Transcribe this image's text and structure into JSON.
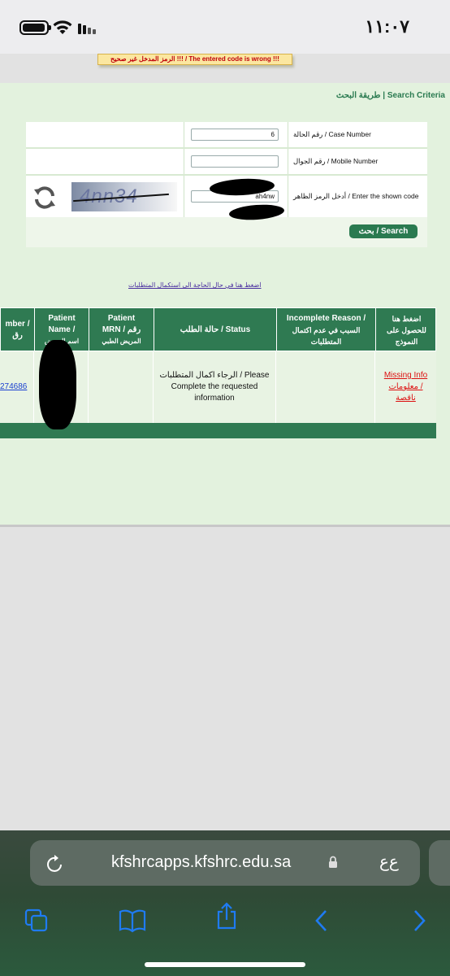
{
  "status": {
    "time": "١١:٠٧"
  },
  "page": {
    "error_message": "الرمز المدخل غير صحيح !!! / The entered code is wrong !!!",
    "criteria_title": "طريقة البحث | Search Criteria",
    "form": {
      "case_label": "رقم الحالة / Case Number",
      "case_value": "6",
      "mobile_label": "رقم الجوال / Mobile Number",
      "mobile_value": "",
      "code_label": "أدخل الرمز الظاهر / Enter the shown code",
      "code_value": "ah4nw",
      "captcha_text": "4nn34",
      "search_label": "بحث / Search"
    },
    "requirements_link": "اضغط هنا في حال الحاجة الى استكمال المتطلبات",
    "table": {
      "headers": {
        "case_number": [
          "mber /",
          "رق"
        ],
        "patient_name": [
          "Patient",
          "Name /",
          "اسم المريض"
        ],
        "patient_mrn": [
          "Patient",
          "MRN / رقم",
          "المريض الطبي"
        ],
        "status": [
          "حالة الطلب / Status"
        ],
        "incomplete_reason": [
          "Incomplete Reason /",
          "السبب في عدم اكتمال",
          "المتطلبات"
        ],
        "form_link": [
          "اضغط هنا",
          "للحصول على",
          "النموذج"
        ]
      },
      "rows": [
        {
          "case_number": "274686",
          "patient_name": "",
          "patient_mrn": "",
          "status": [
            "الرجاء اكمال المتطلبات / Please",
            "Complete the requested",
            "information"
          ],
          "incomplete_reason": "",
          "form_link": [
            "Missing Info",
            "معلومات /",
            "ناقصة"
          ]
        }
      ]
    }
  },
  "browser": {
    "url": "kfshrcapps.kfshrc.edu.sa",
    "text_size_label": "ع‌ع",
    "icons": [
      "reload-icon",
      "lock-icon",
      "tabs-icon",
      "bookmarks-icon",
      "share-icon",
      "back-icon",
      "forward-icon"
    ]
  },
  "colors": {
    "brand_green": "#2f7a52",
    "error_red": "#c0000a",
    "link_purple": "#4a2fa0",
    "ios_blue": "#1f7bf2"
  }
}
